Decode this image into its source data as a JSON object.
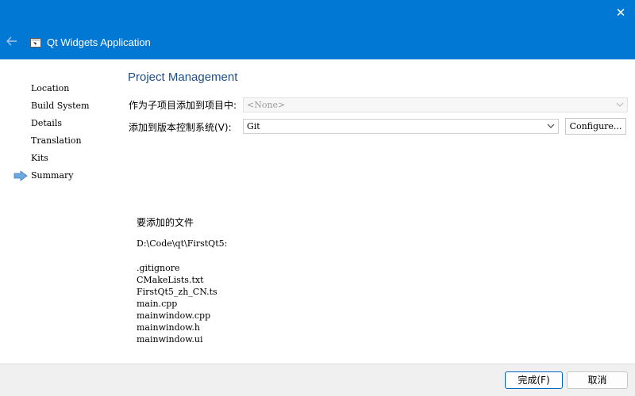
{
  "window": {
    "title": "Qt Widgets Application",
    "close_glyph": "✕",
    "accent_color": "#0078d4",
    "back_icon": "arrow-left-icon",
    "app_icon": "qt-app-icon"
  },
  "sidebar": {
    "steps": [
      {
        "label": "Location"
      },
      {
        "label": "Build System"
      },
      {
        "label": "Details"
      },
      {
        "label": "Translation"
      },
      {
        "label": "Kits"
      },
      {
        "label": "Summary",
        "current": true
      }
    ],
    "current_indicator_icon": "current-step-arrow-icon"
  },
  "main": {
    "title": "Project Management",
    "add_as_subproject_label": "作为子项目添加到项目中:",
    "add_as_subproject_value": "<None>",
    "vcs_label": "添加到版本控制系统(V):",
    "vcs_value": "Git",
    "configure_label": "Configure...",
    "files_heading": "要添加的文件",
    "files_path": "D:\\Code\\qt\\FirstQt5:",
    "files": [
      ".gitignore",
      "CMakeLists.txt",
      "FirstQt5_zh_CN.ts",
      "main.cpp",
      "mainwindow.cpp",
      "mainwindow.h",
      "mainwindow.ui"
    ]
  },
  "footer": {
    "finish_label": "完成(F)",
    "cancel_label": "取消"
  }
}
